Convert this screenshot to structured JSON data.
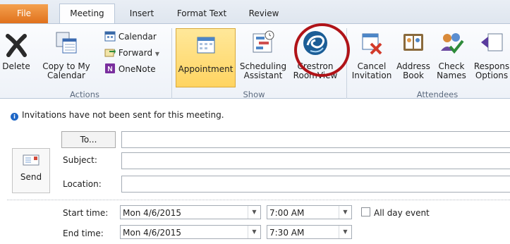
{
  "tabs": [
    "File",
    "Meeting",
    "Insert",
    "Format Text",
    "Review"
  ],
  "ribbon": {
    "actions": {
      "delete": "Delete",
      "copy_line1": "Copy to My",
      "copy_line2": "Calendar",
      "calendar": "Calendar",
      "forward": "Forward",
      "onenote": "OneNote",
      "group": "Actions"
    },
    "show": {
      "appointment": "Appointment",
      "sched_line1": "Scheduling",
      "sched_line2": "Assistant",
      "crestron_line1": "Crestron",
      "crestron_line2": "RoomView",
      "group": "Show"
    },
    "attendees": {
      "cancel_line1": "Cancel",
      "cancel_line2": "Invitation",
      "address_line1": "Address",
      "address_line2": "Book",
      "check_line1": "Check",
      "check_line2": "Names",
      "respons_line1": "Respons",
      "respons_line2": "Options",
      "group": "Attendees"
    }
  },
  "info": "Invitations have not been sent for this meeting.",
  "form": {
    "send": "Send",
    "to": "To...",
    "subject_label": "Subject:",
    "location_label": "Location:",
    "start_label": "Start time:",
    "end_label": "End time:",
    "start_date": "Mon 4/6/2015",
    "start_time": "7:00 AM",
    "end_date": "Mon 4/6/2015",
    "end_time": "7:30 AM",
    "all_day": "All day event",
    "to_value": "",
    "subject_value": "",
    "location_value": ""
  },
  "colors": {
    "file_tab": "#e0711c",
    "highlight_circle": "#b01318",
    "accent_selected": "#ffd461"
  }
}
